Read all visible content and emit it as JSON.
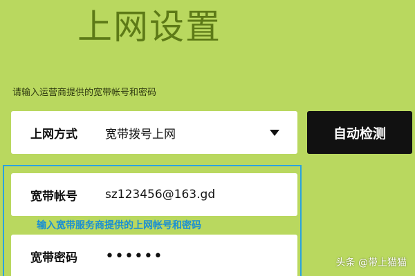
{
  "title": "上网设置",
  "hint": "请输入运营商提供的宽带帐号和密码",
  "connection_mode": {
    "label": "上网方式",
    "value": "宽带拨号上网",
    "icon": "chevron-down-icon"
  },
  "detect_button": {
    "label": "自动检测"
  },
  "account": {
    "label": "宽带帐号",
    "value": "sz123456@163.gd"
  },
  "annotation": "输入宽带服务商提供的上网帐号和密码",
  "password": {
    "label": "宽带密码",
    "value": "••••••"
  },
  "watermark": "头条 @带上猫猫",
  "colors": {
    "background": "#b9d85f",
    "title": "#5d7a17",
    "button_bg": "#111111",
    "highlight": "#2aa3e0",
    "annotation": "#1a8fd4"
  }
}
